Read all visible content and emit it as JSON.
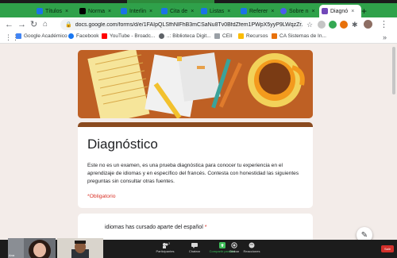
{
  "zoom": {
    "share_banner": "",
    "toolbar": [
      {
        "label": "Participantes",
        "icon": "participants-icon"
      },
      {
        "label": "Chatear",
        "icon": "chat-icon"
      },
      {
        "label": "Compartir pantalla",
        "icon": "share-screen-icon"
      },
      {
        "label": "Grabar",
        "icon": "record-icon"
      },
      {
        "label": "Reacciones",
        "icon": "reactions-icon"
      }
    ],
    "participant_count": "3",
    "end_label": "Salir",
    "participants": [
      {
        "label": "Ana"
      },
      {
        "label": ""
      }
    ]
  },
  "tabs": [
    {
      "label": "Títulos",
      "active": false,
      "color": "#1a73e8"
    },
    {
      "label": "Norma",
      "active": false,
      "color": "#000000"
    },
    {
      "label": "Interlin",
      "active": false,
      "color": "#1a73e8"
    },
    {
      "label": "Cita de",
      "active": false,
      "color": "#1a73e8"
    },
    {
      "label": "Listas",
      "active": false,
      "color": "#1a73e8"
    },
    {
      "label": "Referer",
      "active": false,
      "color": "#1a73e8"
    },
    {
      "label": "Sobre n",
      "active": false,
      "color": "#4a5cf0"
    },
    {
      "label": "Diagnó",
      "active": true,
      "color": "#7248b9"
    }
  ],
  "toolbar": {
    "url": "docs.google.com/forms/d/e/1FAIpQLSfhNlFhB3mCSaNu8Tv0BfdZfem1PWpX5yyP9LWqzZr..."
  },
  "bookmarks": [
    {
      "label": "Google Académico",
      "color": "#4285f4"
    },
    {
      "label": "Facebook",
      "color": "#1877f2"
    },
    {
      "label": "YouTube - Broadc...",
      "color": "#ff0000"
    },
    {
      "label": "..: Biblioteca Digit...",
      "color": "#5f6368"
    },
    {
      "label": "CEII",
      "color": "#9aa0a6"
    },
    {
      "label": "Recursos",
      "color": "#fbbc04"
    },
    {
      "label": "CA Sistemas de In...",
      "color": "#e8710a"
    }
  ],
  "form": {
    "title": "Diagnóstico",
    "description": "Este no es un examen, es una prueba diagnóstica para conocer tu experiencia en el aprendizaje de idiomas y en específico del francés. Contesta con honestidad las siguientes preguntas sin consultar otras fuentes.",
    "required_note": "*Obligatorio",
    "question_text": "idiomas has cursado aparte del español",
    "required_mark": "*"
  },
  "colors": {
    "tabstrip": "#2fa14a",
    "header_accent": "#8a4a1f",
    "required": "#d93025"
  }
}
